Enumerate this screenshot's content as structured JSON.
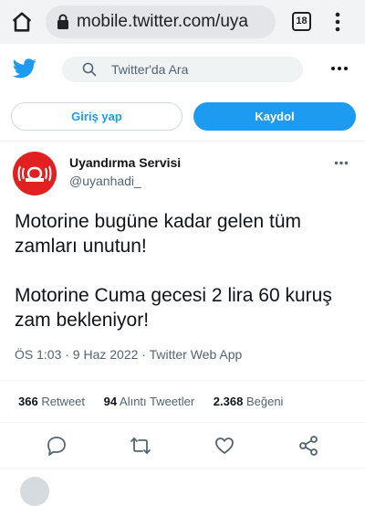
{
  "browser": {
    "url": "mobile.twitter.com/uya",
    "tab_count": "18"
  },
  "twitter": {
    "search_placeholder": "Twitter'da Ara",
    "login_label": "Giriş yap",
    "signup_label": "Kaydol",
    "accent_color": "#1d9bf0"
  },
  "tweet": {
    "author_name": "Uyandırma Servisi",
    "author_handle": "@uyanhadi_",
    "text_line_1": "Motorine bugüne kadar gelen tüm zamları unutun!",
    "text_line_2": "Motorine Cuma gecesi 2 lira 60 kuruş zam bekleniyor!",
    "meta": "ÖS 1:03 · 9 Haz 2022 · Twitter Web App",
    "stats": [
      {
        "count": "366",
        "label": "Retweet"
      },
      {
        "count": "94",
        "label": "Alıntı Tweetler"
      },
      {
        "count": "2.368",
        "label": "Beğeni"
      }
    ],
    "actions": [
      "reply-icon",
      "retweet-icon",
      "like-icon",
      "share-icon"
    ]
  }
}
